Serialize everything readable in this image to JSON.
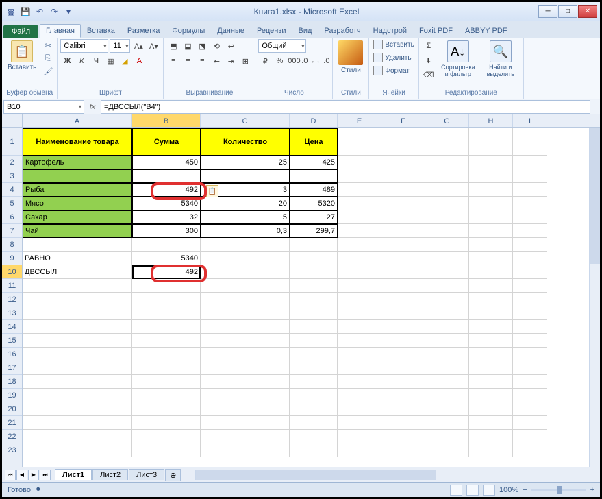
{
  "title": "Книга1.xlsx - Microsoft Excel",
  "tabs": {
    "file": "Файл",
    "home": "Главная",
    "insert": "Вставка",
    "layout": "Разметка",
    "formulas": "Формулы",
    "data": "Данные",
    "review": "Рецензи",
    "view": "Вид",
    "developer": "Разработч",
    "addins": "Надстрой",
    "foxit": "Foxit PDF",
    "abbyy": "ABBYY PDF"
  },
  "ribbon": {
    "paste": "Вставить",
    "clipboard": "Буфер обмена",
    "font_name": "Calibri",
    "font_size": "11",
    "font": "Шрифт",
    "alignment": "Выравнивание",
    "number_format": "Общий",
    "number": "Число",
    "styles": "Стили",
    "styles_btn": "Стили",
    "insert_btn": "Вставить",
    "delete_btn": "Удалить",
    "format_btn": "Формат",
    "cells": "Ячейки",
    "sort": "Сортировка и фильтр",
    "find": "Найти и выделить",
    "editing": "Редактирование"
  },
  "namebox": "B10",
  "formula": "=ДВССЫЛ(\"B4\")",
  "cols": [
    "A",
    "B",
    "C",
    "D",
    "E",
    "F",
    "G",
    "H",
    "I"
  ],
  "headers": {
    "name": "Наименование товара",
    "sum": "Сумма",
    "qty": "Количество",
    "price": "Цена"
  },
  "rows": [
    {
      "n": "2",
      "name": "Картофель",
      "sum": "450",
      "qty": "25",
      "price": "425"
    },
    {
      "n": "3",
      "name": "",
      "sum": "",
      "qty": "",
      "price": ""
    },
    {
      "n": "4",
      "name": "Рыба",
      "sum": "492",
      "qty": "3",
      "price": "489"
    },
    {
      "n": "5",
      "name": "Мясо",
      "sum": "5340",
      "qty": "20",
      "price": "5320"
    },
    {
      "n": "6",
      "name": "Сахар",
      "sum": "32",
      "qty": "5",
      "price": "27"
    },
    {
      "n": "7",
      "name": "Чай",
      "sum": "300",
      "qty": "0,3",
      "price": "299,7"
    }
  ],
  "extra": {
    "r9a": "РАВНО",
    "r9b": "5340",
    "r10a": "ДВССЫЛ",
    "r10b": "492"
  },
  "sheets": {
    "s1": "Лист1",
    "s2": "Лист2",
    "s3": "Лист3"
  },
  "status": "Готово",
  "zoom": "100%"
}
